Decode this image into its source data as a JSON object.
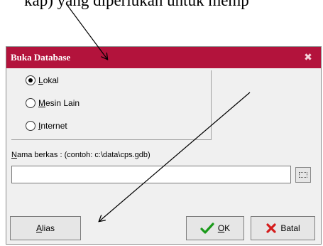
{
  "caption": "kap) yang diperlukan untuk memp",
  "dialog": {
    "title": "Buka Database",
    "close_glyph": "✖",
    "radio_options": [
      {
        "label_underlined": "L",
        "label_rest": "okal",
        "selected": true
      },
      {
        "label_underlined": "M",
        "label_rest": "esin Lain",
        "selected": false
      },
      {
        "label_underlined": "I",
        "label_rest": "nternet",
        "selected": false
      }
    ],
    "filename_label_underlined": "N",
    "filename_label_rest": "ama berkas :  (contoh: c:\\data\\cps.gdb)",
    "filename_value": "",
    "buttons": {
      "alias_underlined": "A",
      "alias_rest": "lias",
      "ok_underlined": "O",
      "ok_rest": "K",
      "cancel_label": "Batal"
    }
  },
  "colors": {
    "titlebar": "#b3133c",
    "ok_check": "#1a9a1a",
    "cancel_x": "#d41c1c"
  },
  "icons": {
    "close": "close-icon",
    "browse": "folder-browse-icon",
    "ok": "checkmark-icon",
    "cancel": "x-cancel-icon"
  }
}
